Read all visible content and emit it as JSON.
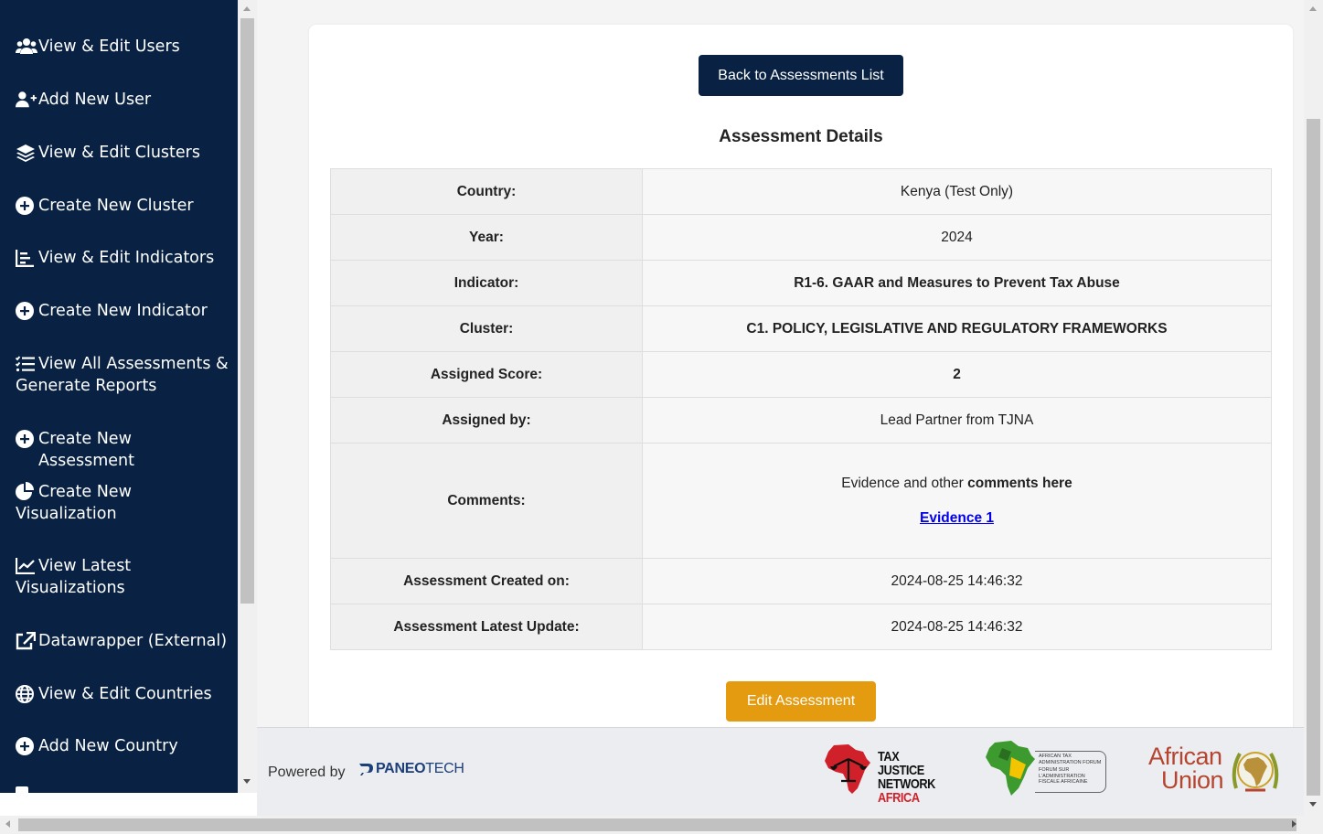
{
  "sidebar": {
    "items": [
      {
        "label": "View & Edit Users",
        "icon": "users-icon"
      },
      {
        "label": "Add New User",
        "icon": "user-plus-icon"
      },
      {
        "label": "View & Edit Clusters",
        "icon": "layers-icon"
      },
      {
        "label": "Create New Cluster",
        "icon": "plus-circle-icon"
      },
      {
        "label": "View & Edit Indicators",
        "icon": "bar-chart-icon"
      },
      {
        "label": "Create New Indicator",
        "icon": "plus-circle-icon"
      },
      {
        "label": "View All Assessments & Generate Reports",
        "icon": "list-check-icon"
      },
      {
        "label": "Create New Assessment",
        "icon": "plus-circle-icon"
      },
      {
        "label": "Create New Visualization",
        "icon": "pie-chart-icon"
      },
      {
        "label": "View Latest Visualizations",
        "icon": "line-chart-icon"
      },
      {
        "label": "Datawrapper (External)",
        "icon": "external-link-icon"
      },
      {
        "label": "View & Edit Countries",
        "icon": "globe-icon"
      },
      {
        "label": "Add New Country",
        "icon": "plus-circle-icon"
      }
    ]
  },
  "main": {
    "back_button": "Back to Assessments List",
    "title": "Assessment Details",
    "rows": {
      "country": {
        "label": "Country:",
        "value": "Kenya (Test Only)"
      },
      "year": {
        "label": "Year:",
        "value": "2024"
      },
      "indicator": {
        "label": "Indicator:",
        "value": "R1-6. GAAR and Measures to Prevent Tax Abuse"
      },
      "cluster": {
        "label": "Cluster:",
        "value": "C1. POLICY, LEGISLATIVE AND REGULATORY FRAMEWORKS"
      },
      "score": {
        "label": "Assigned Score:",
        "value": "2"
      },
      "assigned_by": {
        "label": "Assigned by:",
        "value": "Lead Partner from TJNA"
      },
      "comments": {
        "label": "Comments:",
        "text_plain": "Evidence and other ",
        "text_bold": "comments here",
        "link": "Evidence 1"
      },
      "created": {
        "label": "Assessment Created on:",
        "value": "2024-08-25 14:46:32"
      },
      "updated": {
        "label": "Assessment Latest Update:",
        "value": "2024-08-25 14:46:32"
      }
    },
    "edit_button": "Edit Assessment"
  },
  "footer": {
    "powered_by": "Powered by",
    "paneo_bold": "PANEO",
    "paneo_light": "TECH",
    "tjn": {
      "line1": "TAX JUSTICE",
      "line2": "NETWORK",
      "line3": "AFRICA"
    },
    "ataf": {
      "line1": "AFRICAN TAX",
      "line2": "ADMINISTRATION FORUM",
      "line3": "FORUM SUR",
      "line4": "L'ADMINISTRATION",
      "line5": "FISCALE AFRICAINE"
    },
    "au": {
      "line1": "African",
      "line2": "Union"
    }
  },
  "colors": {
    "sidebar": "#092243",
    "primary_button": "#092243",
    "edit_button": "#e49b0f",
    "link": "#0000ee"
  }
}
